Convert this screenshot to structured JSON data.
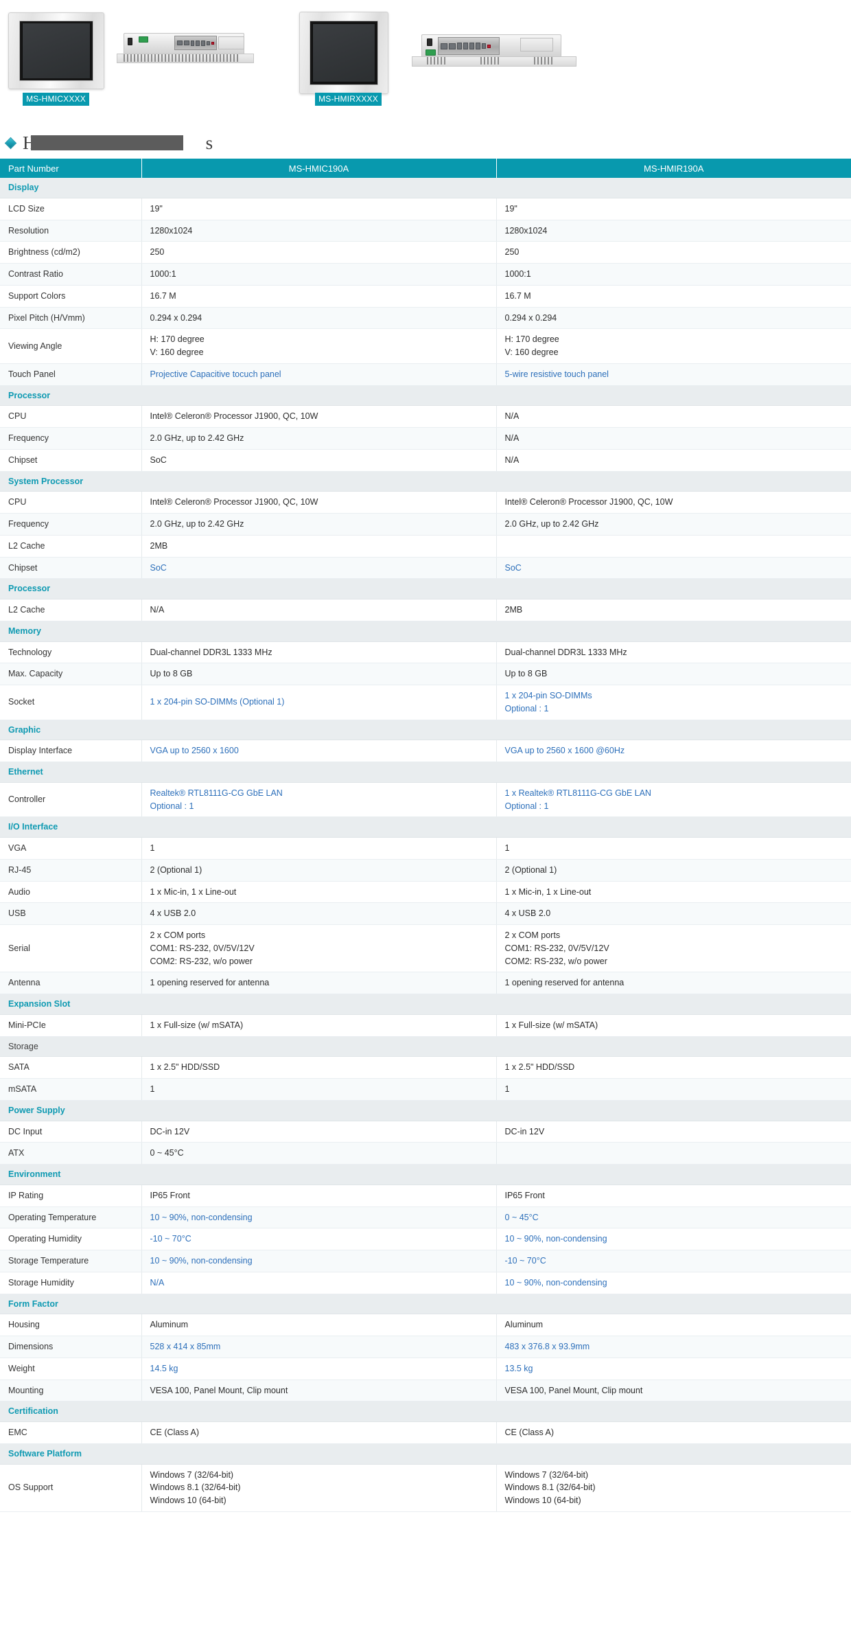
{
  "gallery": {
    "products": [
      {
        "badge": "MS-HMICXXXX"
      },
      {
        "badge": "MS-HMIRXXXX"
      }
    ]
  },
  "section": {
    "icon": "diamond-icon",
    "title_prefix": "H",
    "title_suffix": "s",
    "redacted": true
  },
  "table": {
    "headers": {
      "part_number": "Part Number",
      "col_a": "MS-HMIC190A",
      "col_b": "MS-HMIR190A"
    },
    "rows": [
      {
        "type": "group",
        "label": "Display"
      },
      {
        "type": "row",
        "label": "LCD Size",
        "a": "19\"",
        "b": "19\""
      },
      {
        "type": "row",
        "label": "Resolution",
        "a": "1280x1024",
        "b": "1280x1024"
      },
      {
        "type": "row",
        "label": "Brightness (cd/m2)",
        "a": "250",
        "b": "250"
      },
      {
        "type": "row",
        "label": "Contrast Ratio",
        "a": "1000:1",
        "b": "1000:1"
      },
      {
        "type": "row",
        "label": "Support Colors",
        "a": "16.7 M",
        "b": "16.7 M"
      },
      {
        "type": "row",
        "label": "Pixel Pitch (H/Vmm)",
        "a": "0.294 x 0.294",
        "b": "0.294 x 0.294"
      },
      {
        "type": "row",
        "tall": true,
        "label": "Viewing Angle",
        "a": "H: 170 degree\nV: 160 degree",
        "b": "H: 170 degree\nV: 160 degree"
      },
      {
        "type": "row",
        "label": "Touch Panel",
        "a": "Projective Capacitive tocuch panel",
        "b": "5-wire resistive touch panel",
        "a_blue": true,
        "b_blue": true
      },
      {
        "type": "group",
        "label": "Processor"
      },
      {
        "type": "row",
        "label": "CPU",
        "a": "Intel® Celeron® Processor J1900, QC, 10W",
        "b": "N/A"
      },
      {
        "type": "row",
        "label": "Frequency",
        "a": "2.0 GHz, up to 2.42 GHz",
        "b": "N/A"
      },
      {
        "type": "row",
        "label": "Chipset",
        "a": "SoC",
        "b": "N/A"
      },
      {
        "type": "group",
        "label": "System Processor"
      },
      {
        "type": "row",
        "label": "CPU",
        "a": " Intel® Celeron® Processor J1900, QC, 10W",
        "b": " Intel® Celeron® Processor J1900, QC, 10W"
      },
      {
        "type": "row",
        "label": "Frequency",
        "a": "2.0 GHz, up to 2.42 GHz",
        "b": "2.0 GHz, up to 2.42 GHz"
      },
      {
        "type": "row",
        "label": "L2 Cache",
        "a": "2MB",
        "b": ""
      },
      {
        "type": "row",
        "label": "Chipset",
        "a": "SoC",
        "b": "SoC",
        "a_blue": true,
        "b_blue": true
      },
      {
        "type": "group",
        "label": "Processor"
      },
      {
        "type": "row",
        "label": "L2 Cache",
        "a": "N/A",
        "b": " 2MB"
      },
      {
        "type": "group",
        "label": "Memory"
      },
      {
        "type": "row",
        "label": "Technology",
        "a": "Dual-channel DDR3L 1333 MHz",
        "b": "Dual-channel DDR3L 1333 MHz"
      },
      {
        "type": "row",
        "label": "Max. Capacity",
        "a": "Up to 8 GB",
        "b": "Up to 8 GB"
      },
      {
        "type": "row",
        "tall": true,
        "label": "Socket",
        "a": "1 x 204-pin SO-DIMMs (Optional 1)",
        "b": "1 x 204-pin SO-DIMMs\nOptional : 1",
        "a_blue": true,
        "b_blue": true
      },
      {
        "type": "group",
        "label": "Graphic"
      },
      {
        "type": "row",
        "label": "Display Interface",
        "a": "VGA up to 2560 x 1600",
        "b": "VGA up to 2560 x 1600 @60Hz",
        "a_blue": true,
        "b_blue": true
      },
      {
        "type": "group",
        "label": "Ethernet"
      },
      {
        "type": "row",
        "tall": true,
        "label": "Controller",
        "a": "Realtek® RTL8111G-CG GbE LAN\nOptional : 1",
        "b": "1 x Realtek® RTL8111G-CG GbE LAN\nOptional : 1",
        "a_blue": true,
        "b_blue": true
      },
      {
        "type": "group",
        "label": "I/O Interface"
      },
      {
        "type": "row",
        "label": "VGA",
        "a": "1",
        "b": "1"
      },
      {
        "type": "row",
        "label": "RJ-45",
        "a": "2 (Optional 1)",
        "b": "2 (Optional 1)"
      },
      {
        "type": "row",
        "label": "Audio",
        "a": "1 x Mic-in, 1 x Line-out",
        "b": "1 x Mic-in, 1 x Line-out"
      },
      {
        "type": "row",
        "label": "USB",
        "a": " 4 x USB 2.0",
        "b": " 4 x USB 2.0"
      },
      {
        "type": "row",
        "xtall": true,
        "label": "Serial",
        "a": "2 x COM ports\nCOM1: RS-232, 0V/5V/12V\nCOM2: RS-232, w/o power",
        "b": "2 x COM ports\nCOM1: RS-232, 0V/5V/12V\nCOM2: RS-232, w/o power"
      },
      {
        "type": "row",
        "label": "Antenna",
        "a": "1 opening reserved for antenna",
        "b": "1 opening reserved for antenna"
      },
      {
        "type": "group",
        "label": "Expansion Slot"
      },
      {
        "type": "row",
        "label": "Mini-PCIe",
        "a": "1 x Full-size (w/ mSATA)",
        "b": "1 x Full-size (w/ mSATA)"
      },
      {
        "type": "group",
        "label": "Storage",
        "plain": true
      },
      {
        "type": "row",
        "label": "SATA",
        "a": "1 x 2.5\" HDD/SSD",
        "b": "1 x 2.5\" HDD/SSD"
      },
      {
        "type": "row",
        "label": "mSATA",
        "a": "1",
        "b": "1"
      },
      {
        "type": "group",
        "label": "Power Supply"
      },
      {
        "type": "row",
        "label": "DC Input",
        "a": "DC-in 12V",
        "b": "DC-in 12V"
      },
      {
        "type": "row",
        "label": "ATX",
        "a": "0 ~ 45°C",
        "b": ""
      },
      {
        "type": "group",
        "label": "Environment"
      },
      {
        "type": "row",
        "label": "IP Rating",
        "a": "IP65 Front",
        "b": "IP65 Front"
      },
      {
        "type": "row",
        "label": "Operating Temperature",
        "a": "10 ~ 90%, non-condensing",
        "b": "0 ~ 45°C",
        "a_blue": true,
        "b_blue": true
      },
      {
        "type": "row",
        "label": "Operating Humidity",
        "a": "-10 ~ 70°C",
        "b": "10 ~ 90%, non-condensing",
        "a_blue": true,
        "b_blue": true
      },
      {
        "type": "row",
        "label": "Storage Temperature",
        "a": "10 ~ 90%, non-condensing",
        "b": "-10 ~ 70°C",
        "a_blue": true,
        "b_blue": true
      },
      {
        "type": "row",
        "label": "Storage Humidity",
        "a": "N/A",
        "b": "10 ~ 90%, non-condensing",
        "a_blue": true,
        "b_blue": true
      },
      {
        "type": "group",
        "label": "Form Factor"
      },
      {
        "type": "row",
        "label": "Housing",
        "a": "Aluminum",
        "b": "Aluminum"
      },
      {
        "type": "row",
        "label": "Dimensions",
        "a": "528 x 414 x 85mm",
        "b": "483 x 376.8 x 93.9mm",
        "a_blue": true,
        "b_blue": true
      },
      {
        "type": "row",
        "label": "Weight",
        "a": "14.5 kg",
        "b": "13.5 kg",
        "a_blue": true,
        "b_blue": true
      },
      {
        "type": "row",
        "label": "Mounting",
        "a": "VESA 100, Panel Mount, Clip mount",
        "b": "VESA 100, Panel Mount, Clip mount"
      },
      {
        "type": "group",
        "label": "Certification"
      },
      {
        "type": "row",
        "label": "EMC",
        "a": "CE (Class A)",
        "b": " CE (Class A)"
      },
      {
        "type": "group",
        "label": "Software Platform"
      },
      {
        "type": "row",
        "xtall": true,
        "label": "OS Support",
        "a": "Windows 7 (32/64-bit)\nWindows 8.1 (32/64-bit)\nWindows 10 (64-bit)",
        "b": "Windows 7 (32/64-bit)\nWindows 8.1 (32/64-bit)\nWindows 10 (64-bit)"
      }
    ]
  },
  "colors": {
    "accent": "#0899ae",
    "group_text": "#0f9ab2",
    "link_blue": "#2c6fba",
    "group_bg": "#e9edef",
    "row_alt_bg": "#f7fafb"
  }
}
